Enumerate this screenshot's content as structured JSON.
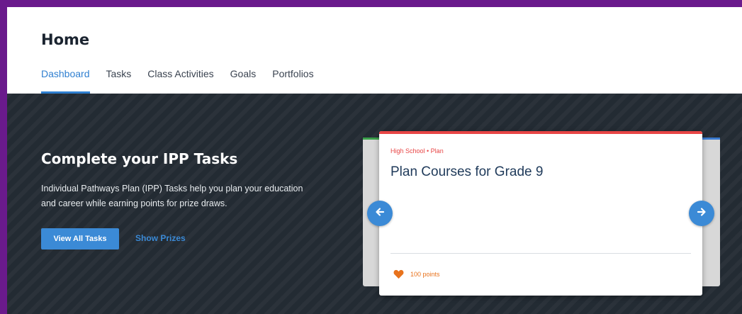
{
  "header": {
    "title": "Home",
    "tabs": [
      {
        "label": "Dashboard",
        "active": true
      },
      {
        "label": "Tasks",
        "active": false
      },
      {
        "label": "Class Activities",
        "active": false
      },
      {
        "label": "Goals",
        "active": false
      },
      {
        "label": "Portfolios",
        "active": false
      }
    ]
  },
  "hero": {
    "title": "Complete your IPP Tasks",
    "description": "Individual Pathways Plan (IPP) Tasks help you plan your education and career while earning points for prize draws.",
    "primary_button": "View All Tasks",
    "secondary_link": "Show Prizes"
  },
  "carousel": {
    "card": {
      "category": "High School • Plan",
      "title": "Plan Courses for Grade 9",
      "points_label": "100 points",
      "accent": "#e84545"
    },
    "prev_icon": "arrow-left-icon",
    "next_icon": "arrow-right-icon"
  },
  "colors": {
    "brand_blue": "#3b8ad6",
    "frame_purple": "#6a1a8c",
    "hero_bg": "#232b33",
    "points_orange": "#e8731d"
  }
}
